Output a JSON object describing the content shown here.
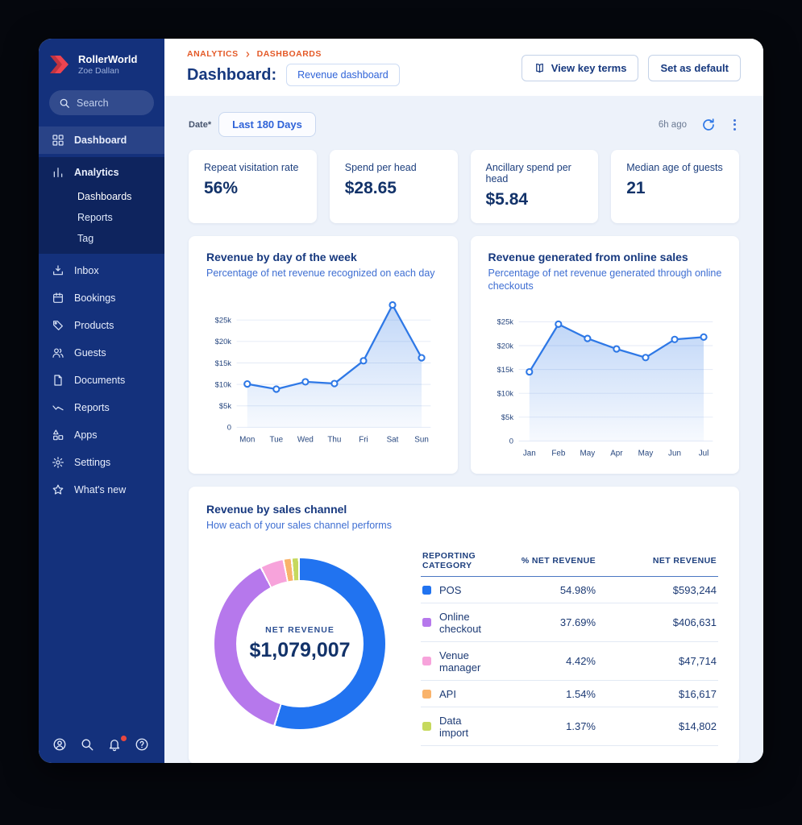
{
  "colors": {
    "sidebar_bg": "#14317c",
    "accent_orange": "#e45a28",
    "link_blue": "#2f63d8",
    "navy": "#17397f",
    "line_blue": "#2e78e6",
    "notification_dot": "#e8473f"
  },
  "sidebar": {
    "brand_name": "RollerWorld",
    "brand_user": "Zoe Dallan",
    "search_placeholder": "Search",
    "items": [
      {
        "id": "dashboard",
        "label": "Dashboard",
        "icon": "grid",
        "state": "highlight"
      },
      {
        "id": "analytics",
        "label": "Analytics",
        "icon": "bar-chart",
        "state": "group",
        "children": [
          {
            "id": "dashboards",
            "label": "Dashboards",
            "active": true
          },
          {
            "id": "reports-sub",
            "label": "Reports",
            "active": false
          },
          {
            "id": "tag",
            "label": "Tag",
            "active": false
          }
        ]
      },
      {
        "id": "inbox",
        "label": "Inbox",
        "icon": "inbox"
      },
      {
        "id": "bookings",
        "label": "Bookings",
        "icon": "calendar"
      },
      {
        "id": "products",
        "label": "Products",
        "icon": "tag"
      },
      {
        "id": "guests",
        "label": "Guests",
        "icon": "users"
      },
      {
        "id": "documents",
        "label": "Documents",
        "icon": "document"
      },
      {
        "id": "reports",
        "label": "Reports",
        "icon": "trend"
      },
      {
        "id": "apps",
        "label": "Apps",
        "icon": "apps"
      },
      {
        "id": "settings",
        "label": "Settings",
        "icon": "gear"
      },
      {
        "id": "whats-new",
        "label": "What's new",
        "icon": "star"
      }
    ],
    "footer_icons": [
      {
        "id": "profile",
        "icon": "profile",
        "badge": false
      },
      {
        "id": "search",
        "icon": "search",
        "badge": false
      },
      {
        "id": "notifications",
        "icon": "notifications",
        "badge": true
      },
      {
        "id": "help",
        "icon": "help",
        "badge": false
      }
    ]
  },
  "header": {
    "breadcrumbs": [
      "ANALYTICS",
      "DASHBOARDS"
    ],
    "title": "Dashboard:",
    "dashboard_chip": "Revenue dashboard",
    "view_key_terms_label": "View key terms",
    "set_default_label": "Set as default"
  },
  "toolbar": {
    "date_label": "Date*",
    "date_value": "Last 180 Days",
    "updated": "6h ago"
  },
  "kpis": [
    {
      "label": "Repeat visitation rate",
      "value": "56%"
    },
    {
      "label": "Spend per head",
      "value": "$28.65"
    },
    {
      "label": "Ancillary spend per head",
      "value": "$5.84"
    },
    {
      "label": "Median age of guests",
      "value": "21"
    }
  ],
  "chart_data": [
    {
      "type": "area",
      "title": "Revenue by day of the week",
      "subtitle": "Percentage of net revenue recognized on each day",
      "categories": [
        "Mon",
        "Tue",
        "Wed",
        "Thu",
        "Fri",
        "Sat",
        "Sun"
      ],
      "values": [
        10100,
        8900,
        10600,
        10200,
        15500,
        28500,
        16200
      ],
      "xlabel": "",
      "ylabel": "",
      "ylim": [
        0,
        30000
      ],
      "ytick_values": [
        0,
        5000,
        10000,
        15000,
        20000,
        25000
      ],
      "ytick_labels": [
        "0",
        "$5k",
        "$10k",
        "$15k",
        "$20k",
        "$25k"
      ],
      "grid": true,
      "legend": false,
      "line_color": "#2e78e6"
    },
    {
      "type": "area",
      "title": "Revenue generated from online sales",
      "subtitle": "Percentage of net revenue generated through online checkouts",
      "categories": [
        "Jan",
        "Feb",
        "May",
        "Apr",
        "May",
        "Jun",
        "Jul"
      ],
      "values": [
        14500,
        24500,
        21500,
        19300,
        17500,
        21300,
        21800
      ],
      "xlabel": "",
      "ylabel": "",
      "ylim": [
        0,
        27000
      ],
      "ytick_values": [
        0,
        5000,
        10000,
        15000,
        20000,
        25000
      ],
      "ytick_labels": [
        "0",
        "$5k",
        "$10k",
        "$15k",
        "$20k",
        "$25k"
      ],
      "grid": true,
      "legend": false,
      "line_color": "#2e78e6"
    },
    {
      "type": "pie",
      "variant": "donut",
      "title": "Revenue by sales channel",
      "subtitle": "How each of your sales channel performs",
      "center_label": "NET REVENUE",
      "center_value": "$1,079,007",
      "segments": [
        {
          "name": "POS",
          "pct": 54.98,
          "revenue": "$593,244",
          "color": "#2173f0"
        },
        {
          "name": "Online checkout",
          "pct": 37.69,
          "revenue": "$406,631",
          "color": "#b678ec"
        },
        {
          "name": "Venue manager",
          "pct": 4.42,
          "revenue": "$47,714",
          "color": "#f7a3db"
        },
        {
          "name": "API",
          "pct": 1.54,
          "revenue": "$16,617",
          "color": "#f9b36b"
        },
        {
          "name": "Data import",
          "pct": 1.37,
          "revenue": "$14,802",
          "color": "#c6d95d"
        }
      ]
    }
  ],
  "sales_table": {
    "headers": [
      "REPORTING CATEGORY",
      "% NET REVENUE",
      "NET REVENUE"
    ]
  }
}
